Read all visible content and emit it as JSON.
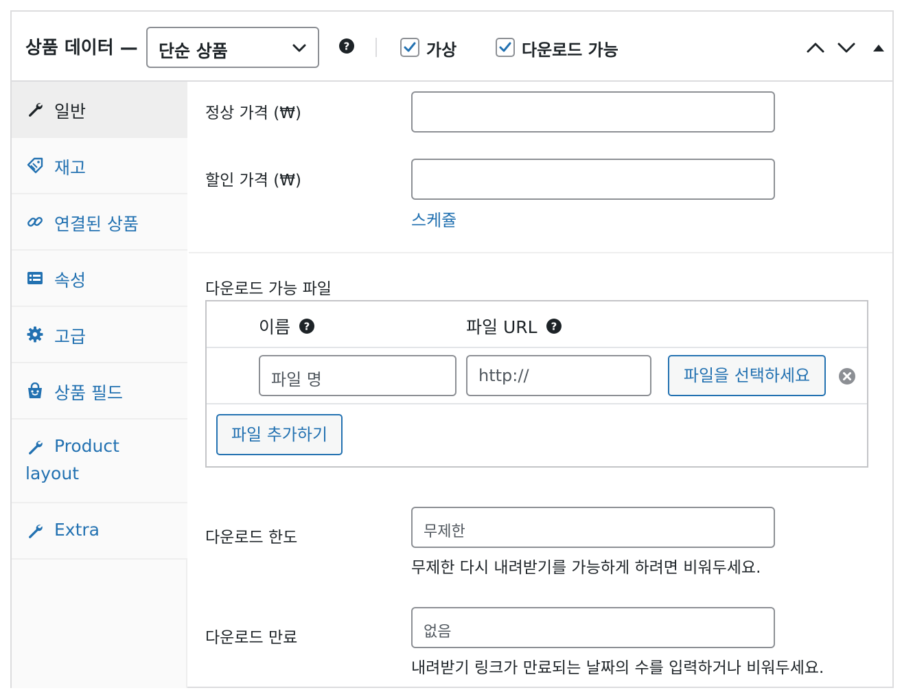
{
  "header": {
    "title": "상품 데이터 —",
    "product_type": "단순 상품",
    "help_icon": "question-circle-icon",
    "virtual_label": "가상",
    "virtual_checked": true,
    "downloadable_label": "다운로드 가능",
    "downloadable_checked": true,
    "controls": [
      "chevron-up-icon",
      "chevron-down-icon",
      "toggle-triangle-icon"
    ]
  },
  "sidebar": {
    "items": [
      {
        "label": "일반",
        "icon": "wrench-icon",
        "active": true
      },
      {
        "label": "재고",
        "icon": "tag-icon"
      },
      {
        "label": "연결된 상품",
        "icon": "link-icon"
      },
      {
        "label": "속성",
        "icon": "list-card-icon"
      },
      {
        "label": "고급",
        "icon": "gear-icon"
      },
      {
        "label": "상품 필드",
        "icon": "shopping-bag-icon"
      },
      {
        "label": "Product",
        "label2": "layout",
        "icon": "wrench-icon"
      },
      {
        "label": "Extra",
        "icon": "wrench-icon"
      }
    ]
  },
  "general": {
    "regular_price_label": "정상 가격 (₩)",
    "regular_price_value": "",
    "sale_price_label": "할인 가격 (₩)",
    "sale_price_value": "",
    "schedule_link": "스케쥴",
    "downloadable_files_label": "다운로드 가능 파일",
    "files_table": {
      "col_name": "이름",
      "col_url": "파일 URL",
      "row": {
        "name_placeholder": "파일 명",
        "url_placeholder": "http://",
        "choose_button": "파일을 선택하세요"
      },
      "add_button": "파일 추가하기"
    },
    "download_limit_label": "다운로드 한도",
    "download_limit_placeholder": "무제한",
    "download_limit_desc": "무제한 다시 내려받기를 가능하게 하려면 비워두세요.",
    "download_expiry_label": "다운로드 만료",
    "download_expiry_placeholder": "없음",
    "download_expiry_desc": "내려받기 링크가 만료되는 날짜의 수를 입력하거나 비워두세요."
  },
  "colors": {
    "link": "#2271b1",
    "text": "#1d2327",
    "border": "#8c8f94"
  }
}
